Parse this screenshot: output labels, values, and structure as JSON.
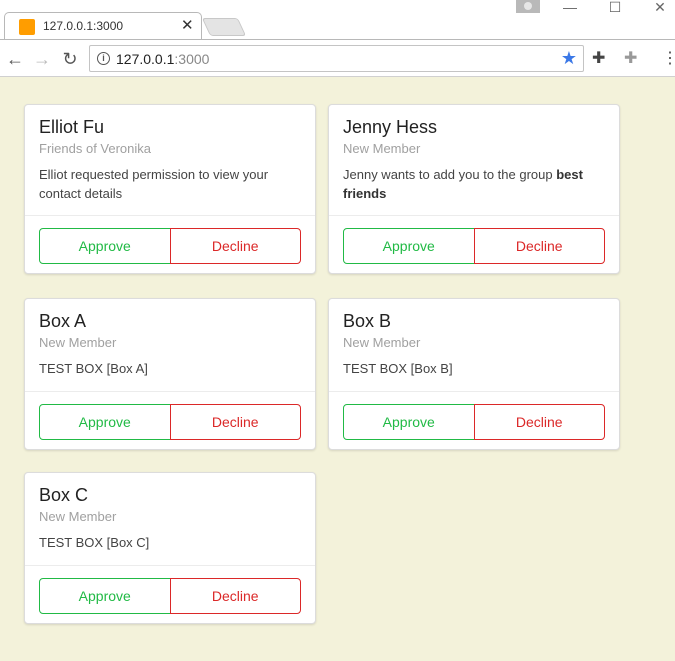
{
  "browser": {
    "tab_title": "127.0.0.1:3000",
    "url_host": "127.0.0.1",
    "url_port": ":3000"
  },
  "cards": [
    {
      "name": "Elliot Fu",
      "meta": "Friends of Veronika",
      "description": "Elliot requested permission to view your contact details",
      "description_bold": "",
      "approve_label": "Approve",
      "decline_label": "Decline"
    },
    {
      "name": "Jenny Hess",
      "meta": "New Member",
      "description": "Jenny wants to add you to the group ",
      "description_bold": "best friends",
      "approve_label": "Approve",
      "decline_label": "Decline"
    },
    {
      "name": "Box A",
      "meta": "New Member",
      "description": "TEST BOX [Box A]",
      "description_bold": "",
      "approve_label": "Approve",
      "decline_label": "Decline"
    },
    {
      "name": "Box B",
      "meta": "New Member",
      "description": "TEST BOX [Box B]",
      "description_bold": "",
      "approve_label": "Approve",
      "decline_label": "Decline"
    },
    {
      "name": "Box C",
      "meta": "New Member",
      "description": "TEST BOX [Box C]",
      "description_bold": "",
      "approve_label": "Approve",
      "decline_label": "Decline"
    }
  ],
  "colors": {
    "page_background": "#f3f2da",
    "approve": "#21ba45",
    "decline": "#db2828"
  },
  "icons": {
    "tab_favicon": "favicon-icon",
    "tab_close": "close-icon",
    "back": "back-arrow-icon",
    "forward": "forward-arrow-icon",
    "reload": "reload-icon",
    "site_info": "info-icon",
    "bookmark": "star-icon",
    "extension1": "puzzle-icon",
    "extension2": "puzzle-icon",
    "menu": "kebab-menu-icon",
    "user": "user-icon",
    "minimize": "minimize-icon",
    "maximize": "maximize-icon",
    "close_window": "close-window-icon"
  }
}
